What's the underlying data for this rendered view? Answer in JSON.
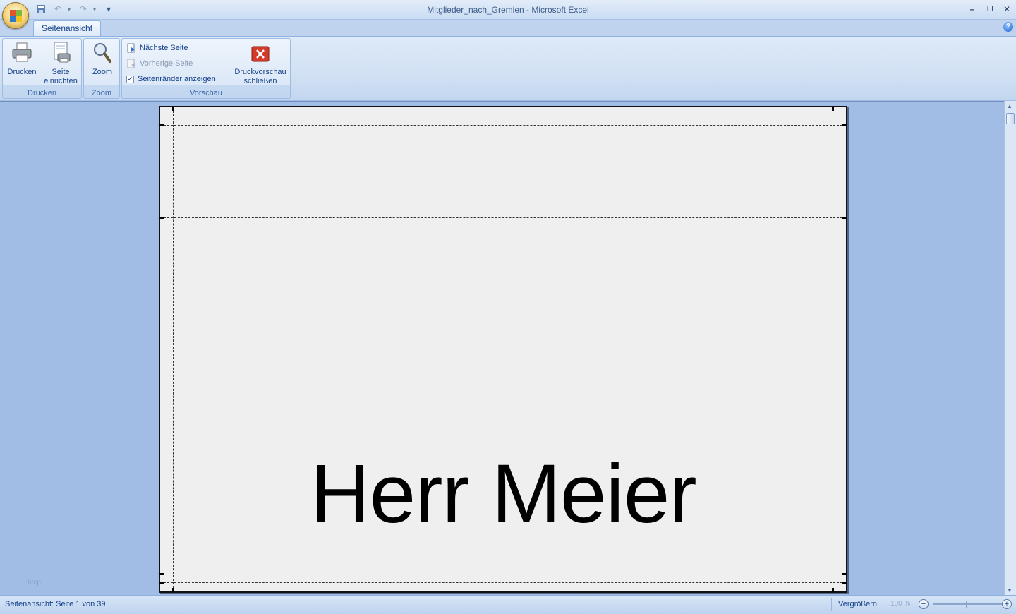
{
  "window": {
    "title": "Mitglieder_nach_Gremien - Microsoft Excel",
    "controls": {
      "minimize": "–",
      "restore": "❐",
      "close": "✕"
    }
  },
  "quick_access": {
    "save_icon": "save-icon",
    "undo_icon": "undo-icon",
    "redo_icon": "redo-icon",
    "customize_glyph": "▾"
  },
  "ribbon": {
    "tab_label": "Seitenansicht",
    "help_glyph": "?",
    "groups": {
      "drucken": {
        "label": "Drucken",
        "print_label": "Drucken",
        "setup_label_1": "Seite",
        "setup_label_2": "einrichten"
      },
      "zoom": {
        "label": "Zoom",
        "zoom_label": "Zoom"
      },
      "vorschau": {
        "label": "Vorschau",
        "next_page": "Nächste Seite",
        "prev_page": "Vorherige Seite",
        "show_margins": "Seitenränder anzeigen",
        "show_margins_checked": true,
        "close_label_1": "Druckvorschau",
        "close_label_2": "schließen"
      }
    }
  },
  "preview": {
    "page_text": "Herr Meier",
    "watermark": "htcp"
  },
  "statusbar": {
    "page_info": "Seitenansicht: Seite 1 von 39",
    "zoom_label": "Vergrößern",
    "zoom_percent": "100 %",
    "zoom_out": "−",
    "zoom_in": "+"
  }
}
